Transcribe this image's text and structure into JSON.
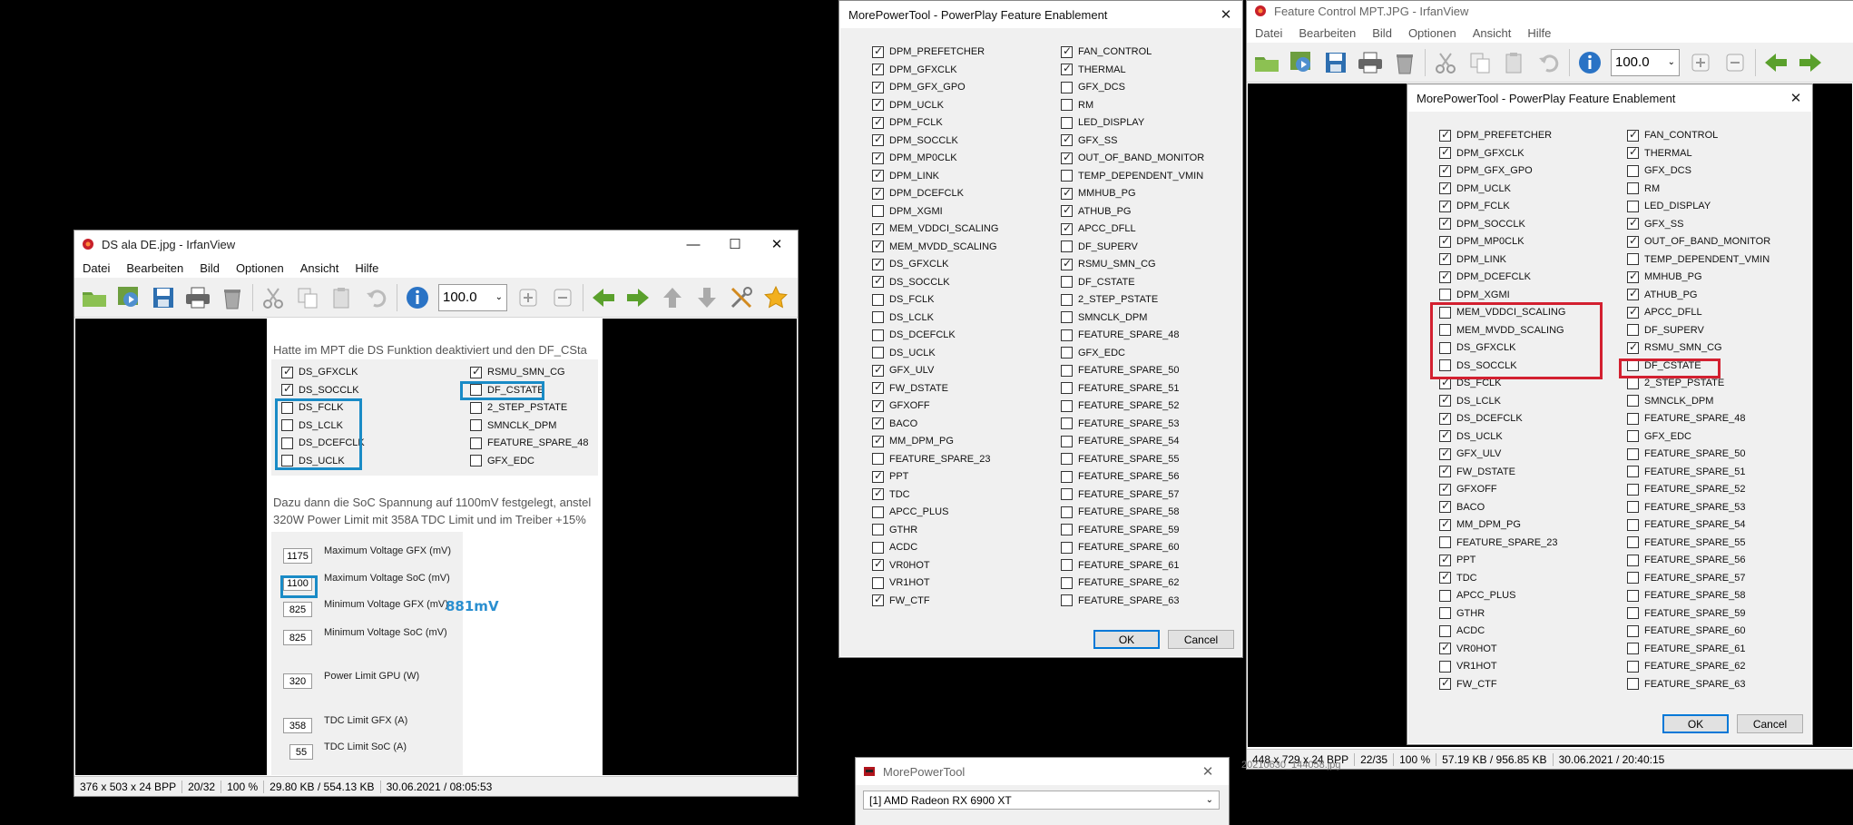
{
  "ds_window": {
    "title": "DS ala DE.jpg - IrfanView",
    "menu": [
      "Datei",
      "Bearbeiten",
      "Bild",
      "Optionen",
      "Ansicht",
      "Hilfe"
    ],
    "zoom": "100.0",
    "status": [
      "376 x 503 x 24 BPP",
      "20/32",
      "100 %",
      "29.80 KB / 554.13 KB",
      "30.06.2021 / 08:05:53"
    ],
    "doc": {
      "para1": "Hatte im MPT die DS Funktion deaktiviert und den DF_CSta",
      "features_left": [
        {
          "label": "DS_GFXCLK",
          "checked": true
        },
        {
          "label": "DS_SOCCLK",
          "checked": true
        },
        {
          "label": "DS_FCLK",
          "checked": false
        },
        {
          "label": "DS_LCLK",
          "checked": false
        },
        {
          "label": "DS_DCEFCLK",
          "checked": false
        },
        {
          "label": "DS_UCLK",
          "checked": false
        }
      ],
      "features_right": [
        {
          "label": "RSMU_SMN_CG",
          "checked": true
        },
        {
          "label": "DF_CSTATE",
          "checked": false
        },
        {
          "label": "2_STEP_PSTATE",
          "checked": false
        },
        {
          "label": "SMNCLK_DPM",
          "checked": false
        },
        {
          "label": "FEATURE_SPARE_48",
          "checked": false
        },
        {
          "label": "GFX_EDC",
          "checked": false
        }
      ],
      "para2": "Dazu dann die SoC Spannung auf 1100mV festgelegt, anstel",
      "para3": "320W Power Limit mit 358A TDC Limit und im Treiber +15%",
      "voltages": [
        {
          "value": "1175",
          "label": "Maximum Voltage GFX (mV)"
        },
        {
          "value": "1100",
          "label": "Maximum Voltage SoC (mV)"
        },
        {
          "value": "825",
          "label": "Minimum Voltage GFX (mV)"
        },
        {
          "value": "825",
          "label": "Minimum Voltage SoC (mV)"
        },
        {
          "value": "320",
          "label": "Power Limit GPU (W)"
        },
        {
          "value": "358",
          "label": "TDC Limit GFX (A)"
        },
        {
          "value": "55",
          "label": "TDC Limit SoC (A)"
        }
      ],
      "annotation": "881mV"
    }
  },
  "pp_dialog": {
    "title": "MorePowerTool - PowerPlay Feature Enablement",
    "ok": "OK",
    "cancel": "Cancel",
    "col1": [
      [
        "DPM_PREFETCHER",
        true
      ],
      [
        "DPM_GFXCLK",
        true
      ],
      [
        "DPM_GFX_GPO",
        true
      ],
      [
        "DPM_UCLK",
        true
      ],
      [
        "DPM_FCLK",
        true
      ],
      [
        "DPM_SOCCLK",
        true
      ],
      [
        "DPM_MP0CLK",
        true
      ],
      [
        "DPM_LINK",
        true
      ],
      [
        "DPM_DCEFCLK",
        true
      ],
      [
        "DPM_XGMI",
        false
      ],
      [
        "MEM_VDDCI_SCALING",
        true
      ],
      [
        "MEM_MVDD_SCALING",
        true
      ],
      [
        "DS_GFXCLK",
        true
      ],
      [
        "DS_SOCCLK",
        true
      ],
      [
        "DS_FCLK",
        false
      ],
      [
        "DS_LCLK",
        false
      ],
      [
        "DS_DCEFCLK",
        false
      ],
      [
        "DS_UCLK",
        false
      ],
      [
        "GFX_ULV",
        true
      ],
      [
        "FW_DSTATE",
        true
      ],
      [
        "GFXOFF",
        true
      ],
      [
        "BACO",
        true
      ],
      [
        "MM_DPM_PG",
        true
      ],
      [
        "FEATURE_SPARE_23",
        false
      ],
      [
        "PPT",
        true
      ],
      [
        "TDC",
        true
      ],
      [
        "APCC_PLUS",
        false
      ],
      [
        "GTHR",
        false
      ],
      [
        "ACDC",
        false
      ],
      [
        "VR0HOT",
        true
      ],
      [
        "VR1HOT",
        false
      ],
      [
        "FW_CTF",
        true
      ]
    ],
    "col2": [
      [
        "FAN_CONTROL",
        true
      ],
      [
        "THERMAL",
        true
      ],
      [
        "GFX_DCS",
        false
      ],
      [
        "RM",
        false
      ],
      [
        "LED_DISPLAY",
        false
      ],
      [
        "GFX_SS",
        true
      ],
      [
        "OUT_OF_BAND_MONITOR",
        true
      ],
      [
        "TEMP_DEPENDENT_VMIN",
        false
      ],
      [
        "MMHUB_PG",
        true
      ],
      [
        "ATHUB_PG",
        true
      ],
      [
        "APCC_DFLL",
        true
      ],
      [
        "DF_SUPERV",
        false
      ],
      [
        "RSMU_SMN_CG",
        true
      ],
      [
        "DF_CSTATE",
        false
      ],
      [
        "2_STEP_PSTATE",
        false
      ],
      [
        "SMNCLK_DPM",
        false
      ],
      [
        "FEATURE_SPARE_48",
        false
      ],
      [
        "GFX_EDC",
        false
      ],
      [
        "FEATURE_SPARE_50",
        false
      ],
      [
        "FEATURE_SPARE_51",
        false
      ],
      [
        "FEATURE_SPARE_52",
        false
      ],
      [
        "FEATURE_SPARE_53",
        false
      ],
      [
        "FEATURE_SPARE_54",
        false
      ],
      [
        "FEATURE_SPARE_55",
        false
      ],
      [
        "FEATURE_SPARE_56",
        false
      ],
      [
        "FEATURE_SPARE_57",
        false
      ],
      [
        "FEATURE_SPARE_58",
        false
      ],
      [
        "FEATURE_SPARE_59",
        false
      ],
      [
        "FEATURE_SPARE_60",
        false
      ],
      [
        "FEATURE_SPARE_61",
        false
      ],
      [
        "FEATURE_SPARE_62",
        false
      ],
      [
        "FEATURE_SPARE_63",
        false
      ]
    ]
  },
  "mpt_window": {
    "title": "MorePowerTool",
    "gpu": "[1] AMD Radeon RX 6900 XT"
  },
  "fc_window": {
    "title": "Feature Control MPT.JPG - IrfanView",
    "menu": [
      "Datei",
      "Bearbeiten",
      "Bild",
      "Optionen",
      "Ansicht",
      "Hilfe"
    ],
    "zoom": "100.0",
    "status": [
      "448 x 729 x 24 BPP",
      "22/35",
      "100 %",
      "57.19 KB / 956.85 KB",
      "30.06.2021 / 20:40:15"
    ],
    "below_status": "20210630_144058.jpg",
    "dialog": {
      "title": "MorePowerTool - PowerPlay Feature Enablement",
      "ok": "OK",
      "cancel": "Cancel",
      "col1": [
        [
          "DPM_PREFETCHER",
          true
        ],
        [
          "DPM_GFXCLK",
          true
        ],
        [
          "DPM_GFX_GPO",
          true
        ],
        [
          "DPM_UCLK",
          true
        ],
        [
          "DPM_FCLK",
          true
        ],
        [
          "DPM_SOCCLK",
          true
        ],
        [
          "DPM_MP0CLK",
          true
        ],
        [
          "DPM_LINK",
          true
        ],
        [
          "DPM_DCEFCLK",
          true
        ],
        [
          "DPM_XGMI",
          false
        ],
        [
          "MEM_VDDCI_SCALING",
          false
        ],
        [
          "MEM_MVDD_SCALING",
          false
        ],
        [
          "DS_GFXCLK",
          false
        ],
        [
          "DS_SOCCLK",
          false
        ],
        [
          "DS_FCLK",
          true
        ],
        [
          "DS_LCLK",
          true
        ],
        [
          "DS_DCEFCLK",
          true
        ],
        [
          "DS_UCLK",
          true
        ],
        [
          "GFX_ULV",
          true
        ],
        [
          "FW_DSTATE",
          true
        ],
        [
          "GFXOFF",
          true
        ],
        [
          "BACO",
          true
        ],
        [
          "MM_DPM_PG",
          true
        ],
        [
          "FEATURE_SPARE_23",
          false
        ],
        [
          "PPT",
          true
        ],
        [
          "TDC",
          true
        ],
        [
          "APCC_PLUS",
          false
        ],
        [
          "GTHR",
          false
        ],
        [
          "ACDC",
          false
        ],
        [
          "VR0HOT",
          true
        ],
        [
          "VR1HOT",
          false
        ],
        [
          "FW_CTF",
          true
        ]
      ],
      "col2": [
        [
          "FAN_CONTROL",
          true
        ],
        [
          "THERMAL",
          true
        ],
        [
          "GFX_DCS",
          false
        ],
        [
          "RM",
          false
        ],
        [
          "LED_DISPLAY",
          false
        ],
        [
          "GFX_SS",
          true
        ],
        [
          "OUT_OF_BAND_MONITOR",
          true
        ],
        [
          "TEMP_DEPENDENT_VMIN",
          false
        ],
        [
          "MMHUB_PG",
          true
        ],
        [
          "ATHUB_PG",
          true
        ],
        [
          "APCC_DFLL",
          true
        ],
        [
          "DF_SUPERV",
          false
        ],
        [
          "RSMU_SMN_CG",
          true
        ],
        [
          "DF_CSTATE",
          false
        ],
        [
          "2_STEP_PSTATE",
          false
        ],
        [
          "SMNCLK_DPM",
          false
        ],
        [
          "FEATURE_SPARE_48",
          false
        ],
        [
          "GFX_EDC",
          false
        ],
        [
          "FEATURE_SPARE_50",
          false
        ],
        [
          "FEATURE_SPARE_51",
          false
        ],
        [
          "FEATURE_SPARE_52",
          false
        ],
        [
          "FEATURE_SPARE_53",
          false
        ],
        [
          "FEATURE_SPARE_54",
          false
        ],
        [
          "FEATURE_SPARE_55",
          false
        ],
        [
          "FEATURE_SPARE_56",
          false
        ],
        [
          "FEATURE_SPARE_57",
          false
        ],
        [
          "FEATURE_SPARE_58",
          false
        ],
        [
          "FEATURE_SPARE_59",
          false
        ],
        [
          "FEATURE_SPARE_60",
          false
        ],
        [
          "FEATURE_SPARE_61",
          false
        ],
        [
          "FEATURE_SPARE_62",
          false
        ],
        [
          "FEATURE_SPARE_63",
          false
        ]
      ]
    }
  },
  "colors": {
    "highlight_red": "#d32030",
    "highlight_blue": "#1a8bc6",
    "annotation_blue": "#2a8fd0",
    "default_button_border": "#0078d7"
  },
  "icons": {
    "app": "irfanview-icon",
    "toolbar": [
      "open-icon",
      "slideshow-icon",
      "save-icon",
      "print-icon",
      "delete-icon",
      "cut-icon",
      "copy-icon",
      "paste-icon",
      "undo-icon",
      "info-icon",
      "zoom-in-icon",
      "zoom-out-icon",
      "previous-icon",
      "next-icon",
      "up-icon",
      "down-icon",
      "settings-icon",
      "favorite-icon"
    ]
  }
}
